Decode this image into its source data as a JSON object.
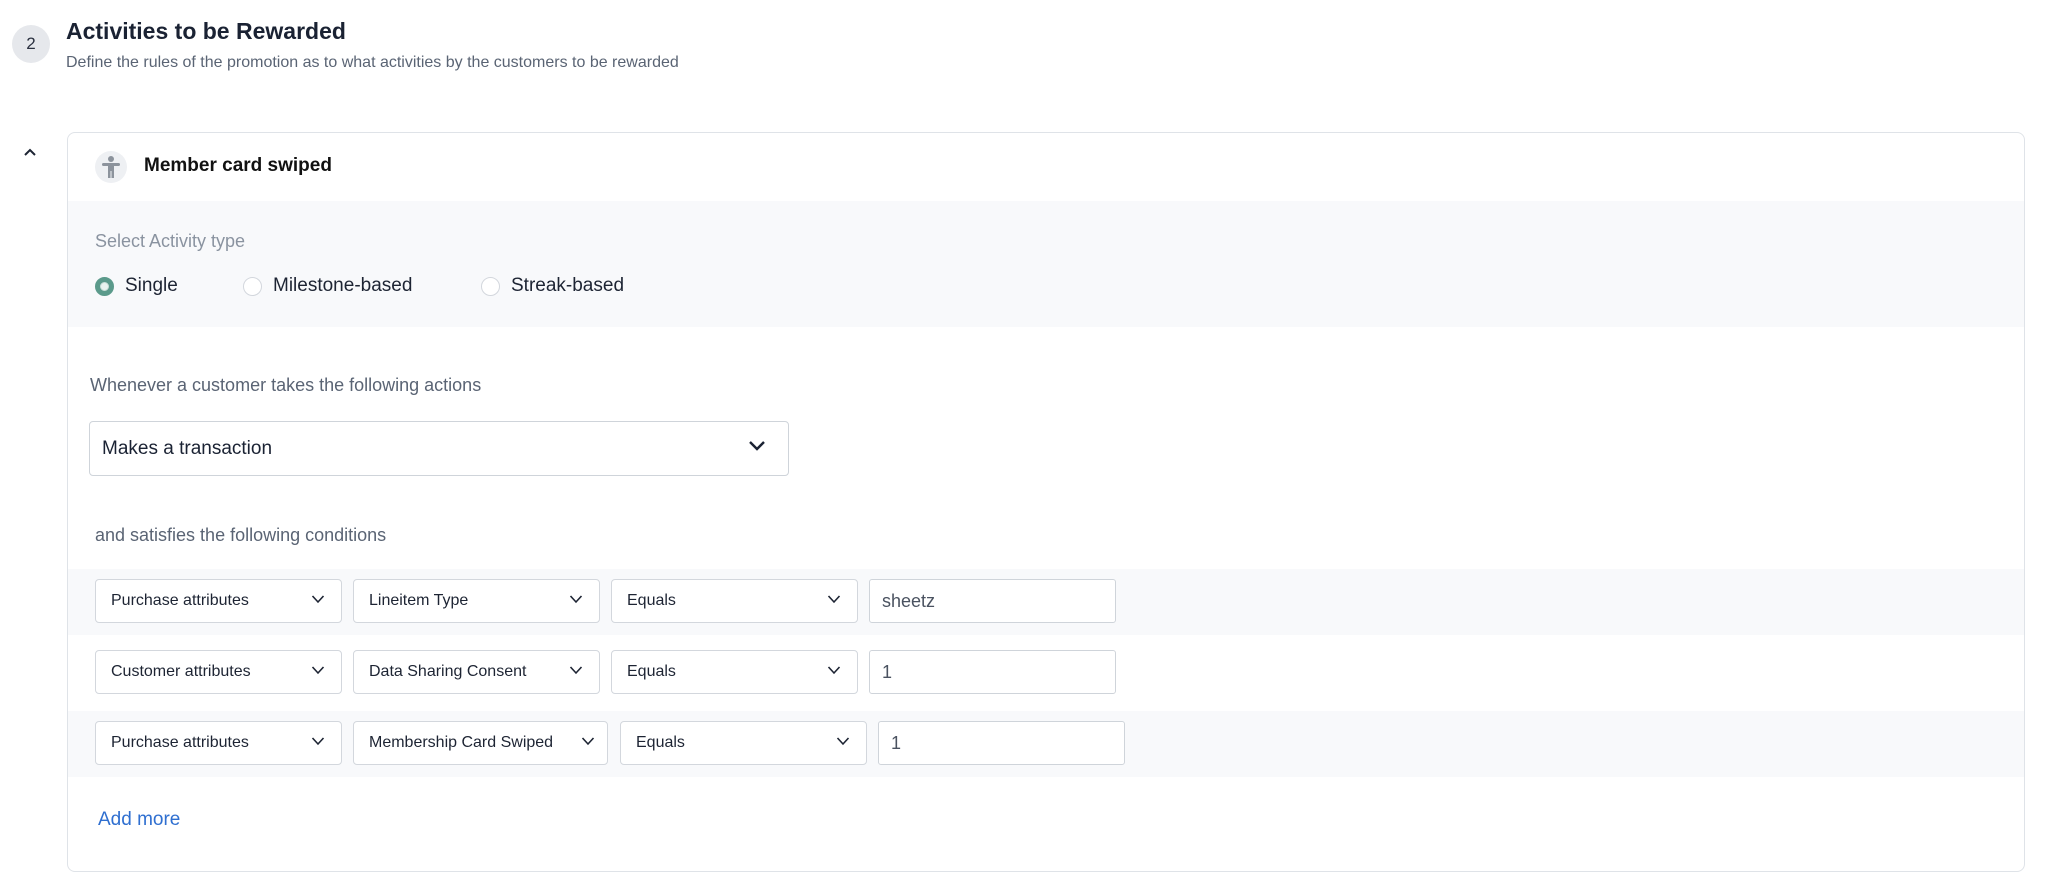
{
  "step": {
    "number": "2",
    "title": "Activities to be Rewarded",
    "subtitle": "Define the rules of the promotion as to what activities by the customers to be rewarded"
  },
  "card": {
    "title": "Member card swiped",
    "icon": "person-icon",
    "activity_type": {
      "label": "Select Activity type",
      "options": [
        "Single",
        "Milestone-based",
        "Streak-based"
      ],
      "selected": "Single"
    },
    "actions_label": "Whenever a customer takes the following actions",
    "action_value": "Makes a transaction",
    "conditions_label": "and satisfies the following conditions",
    "conditions": [
      {
        "category": "Purchase attributes",
        "attribute": "Lineitem Type",
        "operator": "Equals",
        "value": "sheetz"
      },
      {
        "category": "Customer attributes",
        "attribute": "Data Sharing Consent",
        "operator": "Equals",
        "value": "1"
      },
      {
        "category": "Purchase attributes",
        "attribute": "Membership Card Swiped",
        "operator": "Equals",
        "value": "1"
      }
    ],
    "add_more": "Add more"
  },
  "colors": {
    "accent_radio": "#5b9a8b",
    "link": "#2f6fd0",
    "panel_bg": "#f8f9fb"
  }
}
